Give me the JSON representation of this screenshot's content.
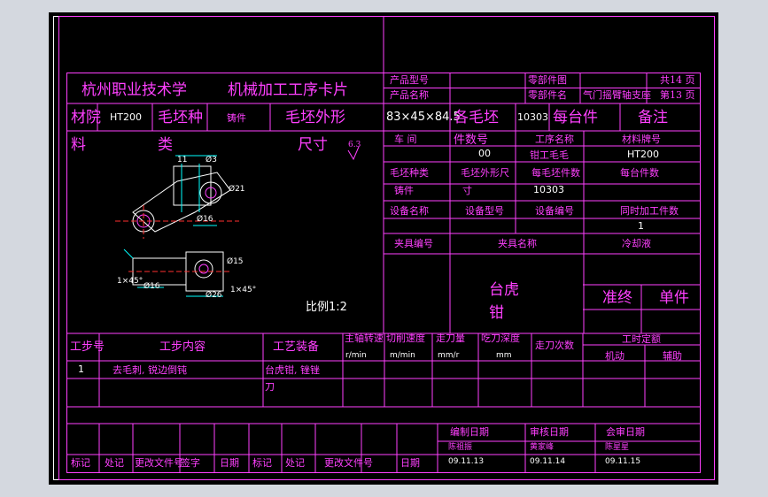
{
  "title": {
    "school": "杭州职业技术学",
    "card": "机械加工工序卡片"
  },
  "header": {
    "product_model_label": "产品型号",
    "product_name_label": "产品名称",
    "part_drawing_label": "零部件图",
    "part_name_label": "零部件名",
    "part_name_value": "气门摇臂轴支座",
    "total_label": "共14 页",
    "page_label": "第13 页"
  },
  "material_row": {
    "college": "材院",
    "material_no": "HT200",
    "blank_type": "毛坯种",
    "casting": "铸件",
    "blank_shape": "毛坯外形",
    "blank_size": "83×45×84.5",
    "per_blank": "各毛坯",
    "count": "10303",
    "per_machine": "每台件",
    "remark": "备注"
  },
  "left_labels": {
    "liao": "料",
    "lei": "类",
    "size": "尺寸",
    "scale": "比例1:2"
  },
  "info_table": {
    "workshop": "车 间",
    "process_no": "件数号",
    "process_no_value": "00",
    "process_name": "工序名称",
    "process_name_value": "钳工毛毛",
    "material_grade": "材料牌号",
    "material_grade_value": "HT200",
    "blank_kind": "毛坯种类",
    "blank_shape_size": "毛坯外形尺",
    "per_blank_count": "每毛坯件数",
    "per_machine_count": "每台件数",
    "casting": "铸件",
    "cun": "寸",
    "blank_count_value": "10303",
    "equipment_name": "设备名称",
    "equipment_model": "设备型号",
    "equipment_no": "设备编号",
    "simultaneous": "同时加工件数",
    "simultaneous_value": "1",
    "fixture_no": "夹具编号",
    "fixture_name": "夹具名称",
    "coolant": "冷却液",
    "fixture_value_1": "台虎",
    "fixture_value_2": "钳",
    "finish": "准终",
    "piece": "单件"
  },
  "steps_table": {
    "step_no": "工步号",
    "step_content": "工步内容",
    "tooling": "工艺装备",
    "spindle_speed": "主轴转速",
    "cutting_speed": "切削速度",
    "feed": "走刀量",
    "depth": "吃刀深度",
    "passes": "走刀次数",
    "time_quota": "工时定额",
    "unit_rpm": "r/min",
    "unit_mpm": "m/min",
    "unit_mmr": "mm/r",
    "unit_mm": "mm",
    "machine": "机动",
    "aux": "辅助",
    "rows": [
      {
        "no": "1",
        "content": "去毛刺, 锐边倒钝",
        "tool_1": "台虎钳, 锉锉",
        "tool_2": "刀"
      }
    ]
  },
  "signoff": {
    "compile_date": "编制日期",
    "review_date": "审核日期",
    "countersign_date": "会审日期",
    "compiler": "陈祖振",
    "reviewer": "黄家峰",
    "countersigner": "陈星星",
    "date_1": "09.11.13",
    "date_2": "09.11.14",
    "date_3": "09.11.15",
    "mark": "标记",
    "place": "处记",
    "change_doc": "更改文件号",
    "signature": "签字",
    "date": "日期"
  },
  "drawing_dims": {
    "d1": "11",
    "d2": "Ø3",
    "d3": "Ø21",
    "d4": "Ø16",
    "d5": "Ø15",
    "d6": "1×45°",
    "d7": "Ø16",
    "d8": "Ø26",
    "d9": "1×45°",
    "rough": "6.3"
  }
}
